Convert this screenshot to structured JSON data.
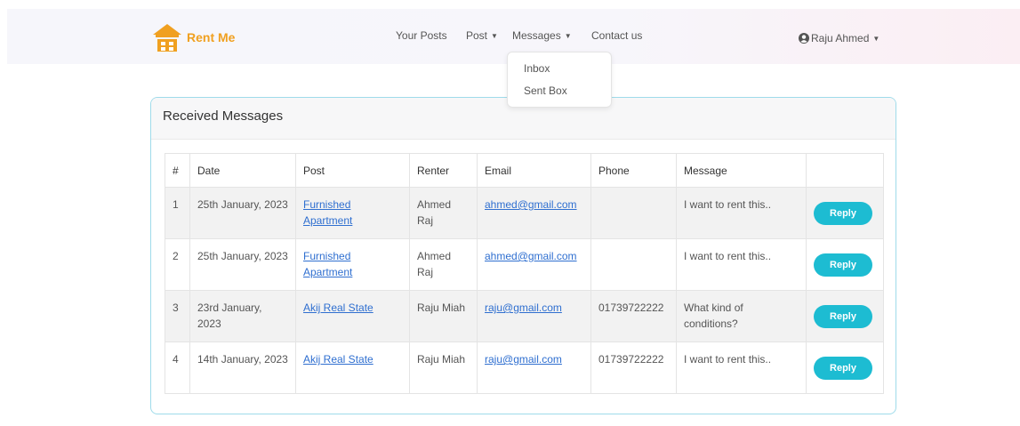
{
  "navbar": {
    "brand": "Rent Me",
    "links": {
      "your_posts": "Your Posts",
      "post": "Post",
      "messages": "Messages",
      "contact": "Contact us"
    },
    "user": "Raju Ahmed",
    "icons": {
      "brand": "house-logo-icon",
      "user": "user-circle-icon",
      "caret": "caret-down-icon"
    }
  },
  "dropdown": {
    "items": [
      "Inbox",
      "Sent Box"
    ]
  },
  "page": {
    "title": "Received Messages",
    "columns": [
      "#",
      "Date",
      "Post",
      "Renter",
      "Email",
      "Phone",
      "Message",
      ""
    ],
    "rows": [
      {
        "num": "1",
        "date": "25th January, 2023",
        "post": "Furnished Apartment",
        "renter": "Ahmed Raj",
        "email": "ahmed@gmail.com",
        "phone": "",
        "message": "I want to rent this..",
        "action": "Reply"
      },
      {
        "num": "2",
        "date": "25th January, 2023",
        "post": "Furnished Apartment",
        "renter": "Ahmed Raj",
        "email": "ahmed@gmail.com",
        "phone": "",
        "message": "I want to rent this..",
        "action": "Reply"
      },
      {
        "num": "3",
        "date": "23rd January, 2023",
        "post": "Akij Real State",
        "renter": "Raju Miah",
        "email": "raju@gmail.com",
        "phone": "01739722222",
        "message": "What kind of conditions?",
        "action": "Reply"
      },
      {
        "num": "4",
        "date": "14th January, 2023",
        "post": "Akij Real State",
        "renter": "Raju Miah",
        "email": "raju@gmail.com",
        "phone": "01739722222",
        "message": "I want to rent this..",
        "action": "Reply"
      }
    ]
  },
  "colors": {
    "brand": "#f0a020",
    "card_border": "#9fdbea",
    "reply_button": "#1dbcd2",
    "link": "#2f6fd0"
  }
}
